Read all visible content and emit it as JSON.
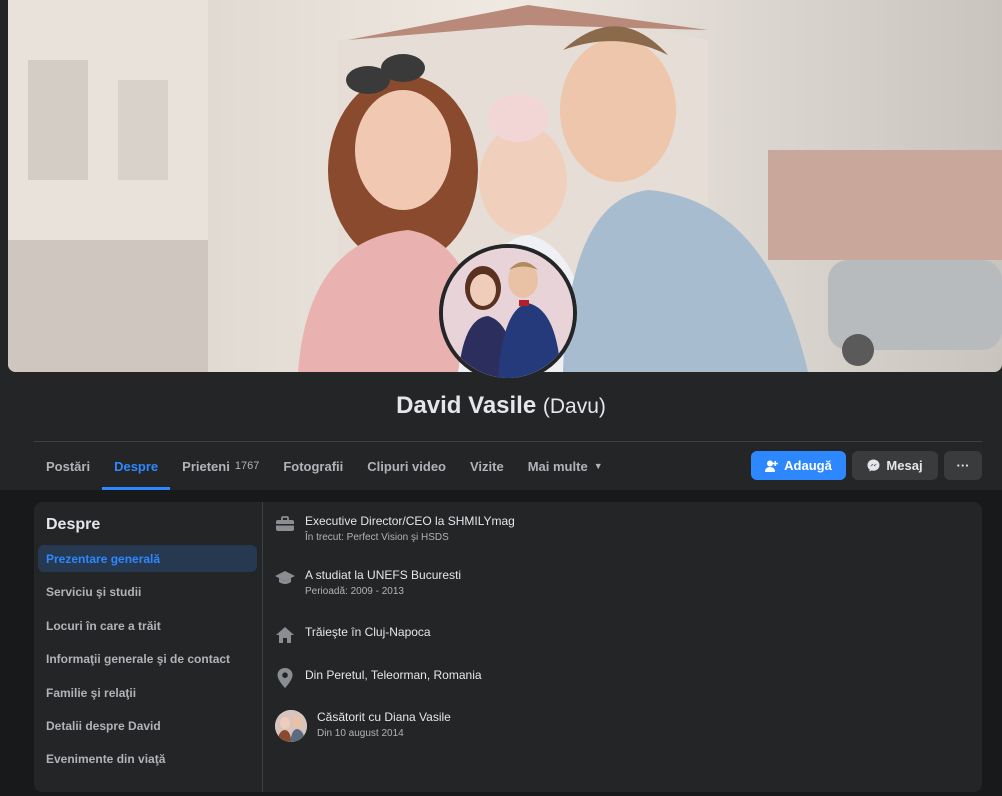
{
  "profile": {
    "name": "David Vasile",
    "nickname": "(Davu)"
  },
  "tabs": [
    {
      "label": "Postări"
    },
    {
      "label": "Despre"
    },
    {
      "label": "Prieteni",
      "count": "1767"
    },
    {
      "label": "Fotografii"
    },
    {
      "label": "Clipuri video"
    },
    {
      "label": "Vizite"
    },
    {
      "label": "Mai multe"
    }
  ],
  "actions": {
    "add": "Adaugă",
    "message": "Mesaj",
    "more": "···"
  },
  "about": {
    "title": "Despre",
    "menu": [
      "Prezentare generală",
      "Serviciu şi studii",
      "Locuri în care a trăit",
      "Informaţii generale şi de contact",
      "Familie şi relaţii",
      "Detalii despre David",
      "Evenimente din viaţă"
    ],
    "items": [
      {
        "icon": "briefcase-icon",
        "main": "Executive Director/CEO la SHMILYmag",
        "sub": "În trecut: Perfect Vision şi HSDS"
      },
      {
        "icon": "graduation-cap-icon",
        "main": "A studiat la UNEFS Bucuresti",
        "sub": "Perioadă: 2009 - 2013"
      },
      {
        "icon": "home-icon",
        "main": "Trăieşte în Cluj-Napoca",
        "sub": ""
      },
      {
        "icon": "location-pin-icon",
        "main": "Din Peretul, Teleorman, Romania",
        "sub": ""
      },
      {
        "icon": "spouse-avatar",
        "main": "Căsătorit cu Diana Vasile",
        "sub": "Din 10 august 2014"
      }
    ]
  },
  "colors": {
    "accent": "#2d88ff",
    "surface": "#242526",
    "background": "#18191a"
  }
}
